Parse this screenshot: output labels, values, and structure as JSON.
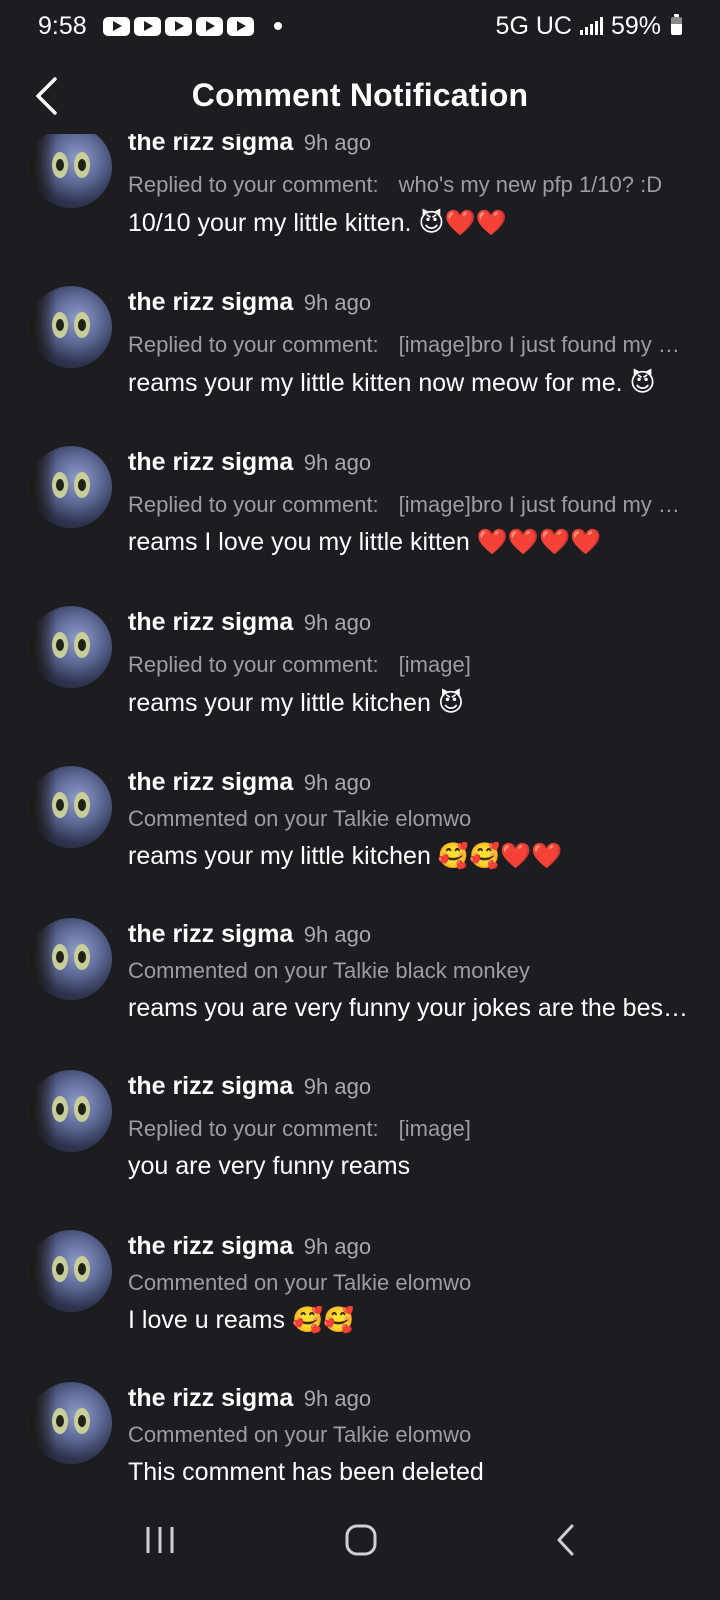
{
  "status_bar": {
    "time": "9:58",
    "network": "5G UC",
    "battery": "59%"
  },
  "header": {
    "title": "Comment Notification"
  },
  "notifications": [
    {
      "name": "the rizz sigma",
      "time": "9h ago",
      "action": "Replied to your comment:",
      "quote": "who's my new pfp 1/10? :D",
      "message": "10/10 your my little kitten. 😈❤️❤️"
    },
    {
      "name": "the rizz sigma",
      "time": "9h ago",
      "action": "Replied to your comment:",
      "quote": "[image]bro I just found my old pfp from last year",
      "message": "reams your my little kitten now meow for me. 😈"
    },
    {
      "name": "the rizz sigma",
      "time": "9h ago",
      "action": "Replied to your comment:",
      "quote": "[image]bro I just found my old pfp from last year",
      "message": "reams I love you my little kitten ❤️❤️❤️❤️"
    },
    {
      "name": "the rizz sigma",
      "time": "9h ago",
      "action": "Replied to your comment:",
      "quote": "[image]",
      "message": "reams your my little kitchen 😈"
    },
    {
      "name": "the rizz sigma",
      "time": "9h ago",
      "action": "Commented on your Talkie elomwo",
      "quote": "",
      "message": "reams your my little kitchen 🥰🥰❤️❤️"
    },
    {
      "name": "the rizz sigma",
      "time": "9h ago",
      "action": "Commented on your Talkie black monkey",
      "quote": "",
      "message": "reams you are very funny your jokes are the best I have ever heard"
    },
    {
      "name": "the rizz sigma",
      "time": "9h ago",
      "action": "Replied to your comment:",
      "quote": "[image]",
      "message": "you are very funny reams"
    },
    {
      "name": "the rizz sigma",
      "time": "9h ago",
      "action": "Commented on your Talkie elomwo",
      "quote": "",
      "message": "I love u reams 🥰🥰"
    },
    {
      "name": "the rizz sigma",
      "time": "9h ago",
      "action": "Commented on your Talkie elomwo",
      "quote": "",
      "message": "This comment has been deleted"
    }
  ],
  "icons": {
    "back": "chevron-left-icon",
    "nav_recents": "recents-icon",
    "nav_home": "home-icon",
    "nav_back": "back-icon"
  },
  "colors": {
    "background": "#1c1d21",
    "primary_text": "#ffffff",
    "secondary_text": "#9c9da2"
  }
}
